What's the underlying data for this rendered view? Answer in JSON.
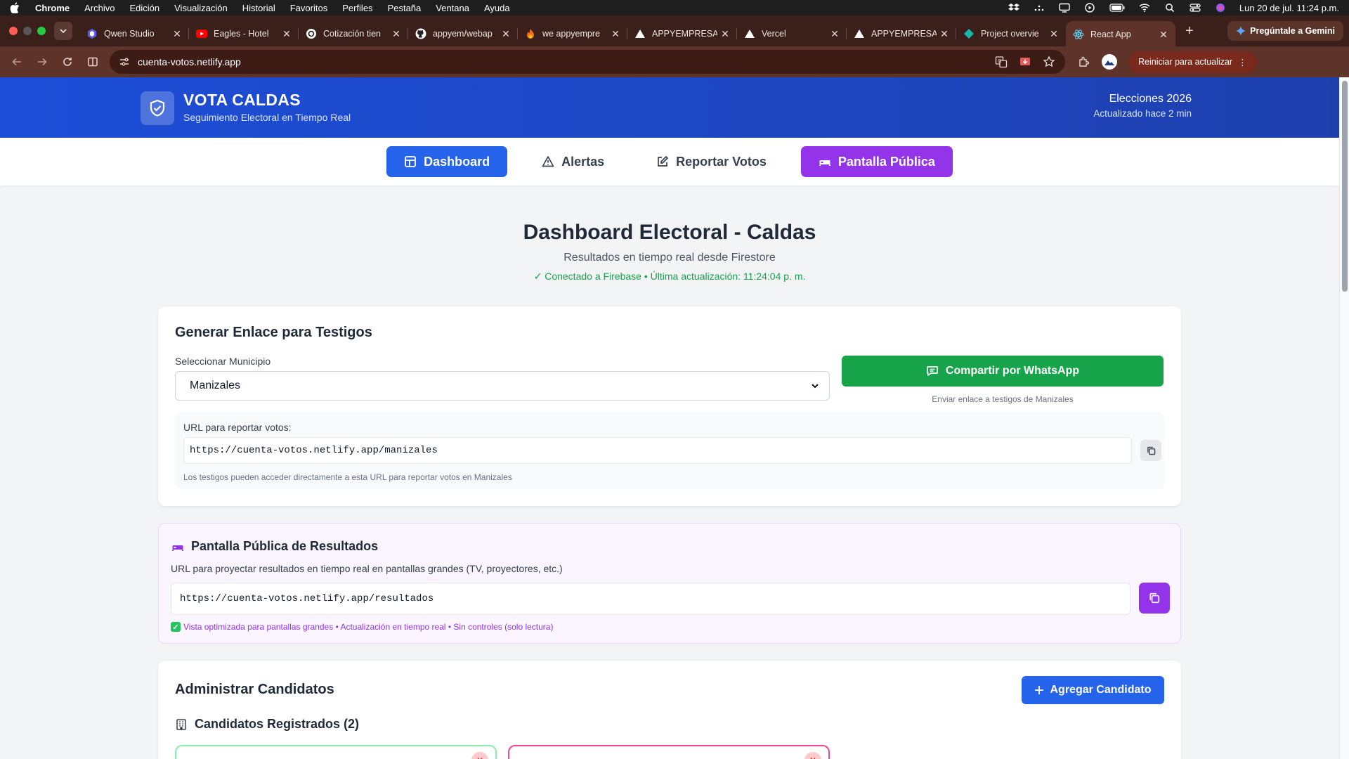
{
  "os_menubar": {
    "app": "Chrome",
    "items": [
      "Archivo",
      "Edición",
      "Visualización",
      "Historial",
      "Favoritos",
      "Perfiles",
      "Pestaña",
      "Ventana",
      "Ayuda"
    ],
    "clock": "Lun 20 de jul.  11:24 p.m."
  },
  "browser": {
    "tabs": [
      {
        "title": "Qwen Studio",
        "icon": "qwen-icon"
      },
      {
        "title": "Eagles - Hotel",
        "icon": "youtube-icon"
      },
      {
        "title": "Cotización tien",
        "icon": "openai-icon"
      },
      {
        "title": "appyem/webap",
        "icon": "github-icon"
      },
      {
        "title": "we appyempre",
        "icon": "flame-icon"
      },
      {
        "title": "APPYEMPRESA",
        "icon": "vercel-icon"
      },
      {
        "title": "Vercel",
        "icon": "vercel-icon"
      },
      {
        "title": "APPYEMPRESA",
        "icon": "vercel-icon"
      },
      {
        "title": "Project overvie",
        "icon": "diamond-icon"
      },
      {
        "title": "React App",
        "icon": "react-icon"
      }
    ],
    "gemini_label": "Pregúntale a Gemini",
    "url": "cuenta-votos.netlify.app",
    "restart_label": "Reiniciar para actualizar"
  },
  "header": {
    "title": "VOTA CALDAS",
    "subtitle": "Seguimiento Electoral en Tiempo Real",
    "election": "Elecciones 2026",
    "updated": "Actualizado hace 2 min"
  },
  "nav": {
    "dashboard": "Dashboard",
    "alerts": "Alertas",
    "report": "Reportar Votos",
    "public": "Pantalla Pública"
  },
  "main": {
    "title": "Dashboard Electoral - Caldas",
    "subtitle": "Resultados en tiempo real desde Firestore",
    "status": "✓ Conectado a Firebase • Última actualización: 11:24:04 p. m."
  },
  "witness_card": {
    "title": "Generar Enlace para Testigos",
    "select_label": "Seleccionar Municipio",
    "selected_municipio": "Manizales",
    "whatsapp_label": "Compartir por WhatsApp",
    "whatsapp_hint": "Enviar enlace a testigos de Manizales",
    "url_label": "URL para reportar votos:",
    "url_value": "https://cuenta-votos.netlify.app/manizales",
    "url_hint": "Los testigos pueden acceder directamente a esta URL para reportar votos en Manizales"
  },
  "public_card": {
    "title": "Pantalla Pública de Resultados",
    "description": "URL para proyectar resultados en tiempo real en pantallas grandes (TV, proyectores, etc.)",
    "url_value": "https://cuenta-votos.netlify.app/resultados",
    "features": "Vista optimizada para pantallas grandes • Actualización en tiempo real • Sin controles (solo lectura)"
  },
  "candidates_card": {
    "title": "Administrar Candidatos",
    "add_label": "Agregar Candidato",
    "registered": "Candidatos Registrados (2)"
  },
  "colors": {
    "primary": "#2563eb",
    "purple": "#9333ea",
    "whatsapp": "#16a34a"
  }
}
